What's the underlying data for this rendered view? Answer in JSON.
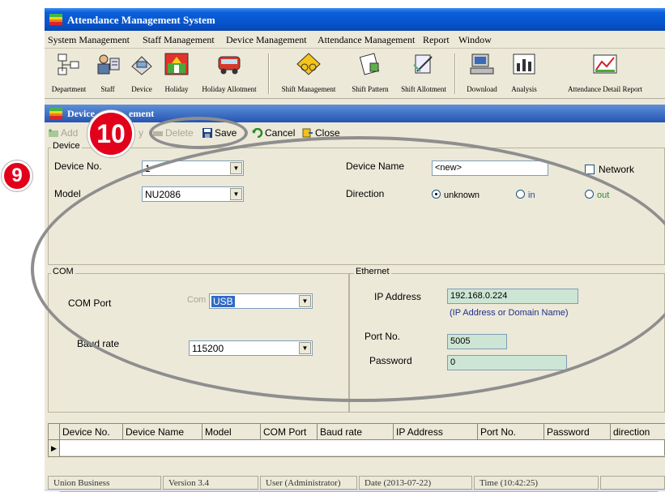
{
  "window": {
    "title": "Attendance Management System"
  },
  "menu": [
    "System Management",
    "Staff Management",
    "Device Management",
    "Attendance Management",
    "Report",
    "Window"
  ],
  "toolbar": [
    "Department",
    "Staff",
    "Device",
    "Holiday",
    "Holiday Allotment",
    "Shift Management",
    "Shift Pattern",
    "Shift Allotment",
    "Download",
    "Analysis",
    "Attendance Detail Report"
  ],
  "child_window": {
    "title_start": "Device",
    "title_end": "ement"
  },
  "form_toolbar": {
    "add": "Add",
    "modify": "y",
    "delete": "Delete",
    "save": "Save",
    "cancel": "Cancel",
    "close": "Close"
  },
  "device": {
    "group_label": "Device",
    "device_no_label": "Device No.",
    "device_no_value": "1",
    "model_label": "Model",
    "model_value": "NU2086",
    "device_name_label": "Device Name",
    "device_name_value": "<new>",
    "network_label": "Network",
    "direction_label": "Direction",
    "direction_options": [
      "unknown",
      "in",
      "out"
    ],
    "direction_selected": "unknown"
  },
  "com": {
    "group_label": "COM",
    "port_label": "COM Port",
    "port_prefix": "Com",
    "port_value": "USB",
    "baud_label": "Baud rate",
    "baud_value": "115200"
  },
  "ethernet": {
    "group_label": "Ethernet",
    "ip_label": "IP Address",
    "ip_value": "192.168.0.224",
    "ip_hint": "(IP Address or Domain Name)",
    "port_label": "Port No.",
    "port_value": "5005",
    "password_label": "Password",
    "password_value": "0"
  },
  "grid": {
    "columns": [
      "Device No.",
      "Device Name",
      "Model",
      "COM Port",
      "Baud rate",
      "IP Address",
      "Port No.",
      "Password",
      "direction"
    ]
  },
  "status": [
    "Union Business",
    "Version 3.4",
    "User (Administrator)",
    "Date (2013-07-22)",
    "Time (10:42:25)"
  ],
  "annotations": {
    "badge_9": "9",
    "badge_10": "10"
  },
  "colors": {
    "badge": "#e2001a",
    "titlebar": "#0653cc",
    "window_bg": "#ece9d8",
    "green_field": "#cde5d4",
    "hint_text": "#1f2f8c"
  }
}
